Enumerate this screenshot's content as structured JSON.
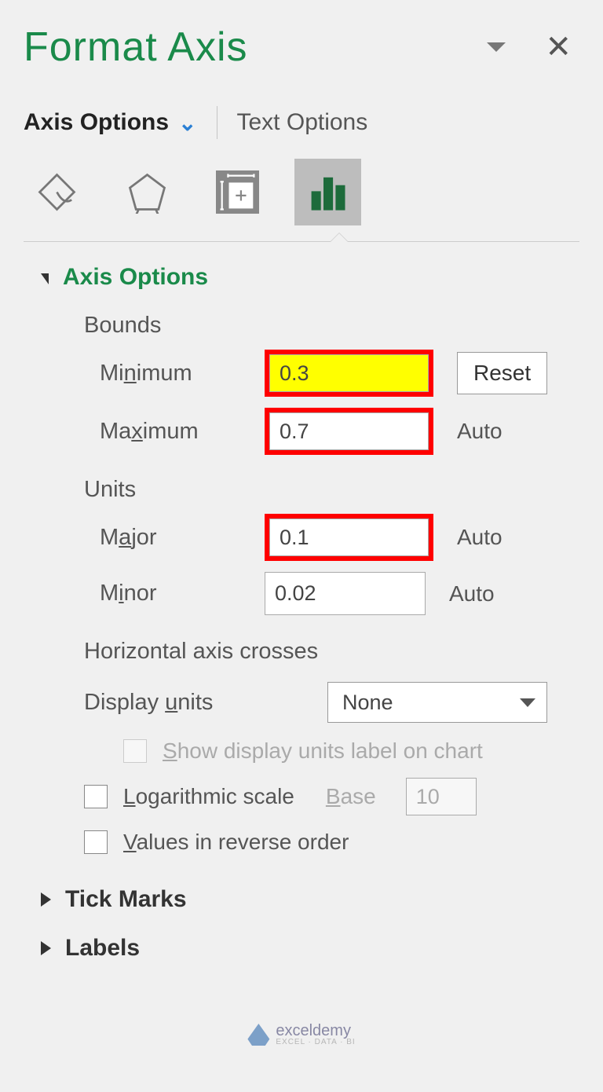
{
  "pane": {
    "title": "Format Axis"
  },
  "tabs": {
    "axis_options": "Axis Options",
    "text_options": "Text Options"
  },
  "sections": {
    "axis_options": {
      "title": "Axis Options",
      "bounds_label": "Bounds",
      "minimum_label": "Minimum",
      "minimum_value": "0.3",
      "minimum_side": "Reset",
      "maximum_label": "Maximum",
      "maximum_value": "0.7",
      "maximum_side": "Auto",
      "units_label": "Units",
      "major_label": "Major",
      "major_value": "0.1",
      "major_side": "Auto",
      "minor_label": "Minor",
      "minor_value": "0.02",
      "minor_side": "Auto",
      "horizontal_crosses": "Horizontal axis crosses",
      "display_units_label": "Display units",
      "display_units_value": "None",
      "show_units_label": "Show display units label on chart",
      "log_scale_label": "Logarithmic scale",
      "base_label": "Base",
      "base_value": "10",
      "reverse_label": "Values in reverse order"
    },
    "tick_marks": {
      "title": "Tick Marks"
    },
    "labels": {
      "title": "Labels"
    }
  },
  "watermark": {
    "main": "exceldemy",
    "sub": "EXCEL · DATA · BI"
  }
}
